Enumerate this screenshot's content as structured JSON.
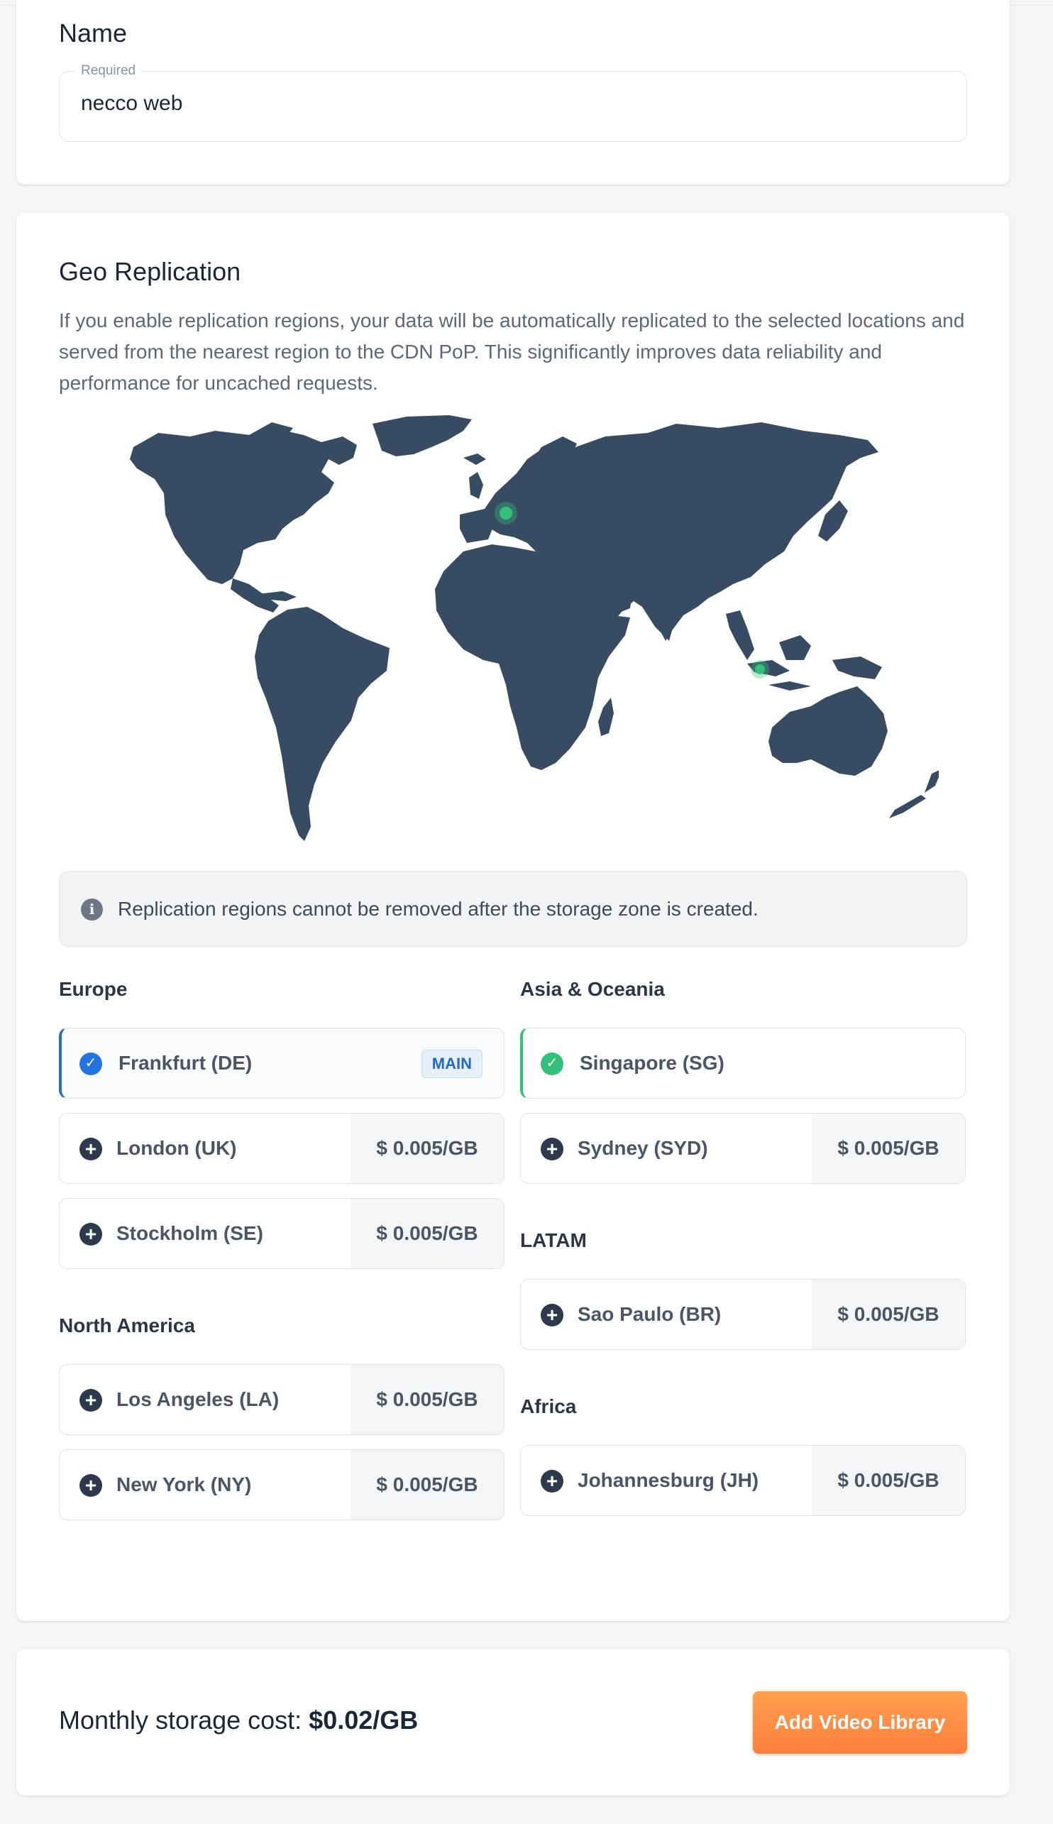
{
  "name_section": {
    "title": "Name",
    "field_label": "Required",
    "field_value": "necco web"
  },
  "geo": {
    "title": "Geo Replication",
    "description": "If you enable replication regions, your data will be automatically replicated to the selected locations and served from the nearest region to the CDN PoP. This significantly improves data reliability and performance for uncached requests.",
    "notice": "Replication regions cannot be removed after the storage zone is created.",
    "groups": {
      "europe": {
        "title": "Europe",
        "items": [
          {
            "label": "Frankfurt (DE)",
            "badge": "MAIN",
            "state": "main"
          },
          {
            "label": "London (UK)",
            "price": "$ 0.005/GB",
            "state": "add"
          },
          {
            "label": "Stockholm (SE)",
            "price": "$ 0.005/GB",
            "state": "add"
          }
        ]
      },
      "north_america": {
        "title": "North America",
        "items": [
          {
            "label": "Los Angeles (LA)",
            "price": "$ 0.005/GB",
            "state": "add"
          },
          {
            "label": "New York (NY)",
            "price": "$ 0.005/GB",
            "state": "add"
          }
        ]
      },
      "asia": {
        "title": "Asia & Oceania",
        "items": [
          {
            "label": "Singapore (SG)",
            "state": "selected"
          },
          {
            "label": "Sydney (SYD)",
            "price": "$ 0.005/GB",
            "state": "add"
          }
        ]
      },
      "latam": {
        "title": "LATAM",
        "items": [
          {
            "label": "Sao Paulo (BR)",
            "price": "$ 0.005/GB",
            "state": "add"
          }
        ]
      },
      "africa": {
        "title": "Africa",
        "items": [
          {
            "label": "Johannesburg (JH)",
            "price": "$ 0.005/GB",
            "state": "add"
          }
        ]
      }
    }
  },
  "cost": {
    "label": "Monthly storage cost: ",
    "value": "$0.02/GB",
    "button": "Add Video Library"
  },
  "colors": {
    "map_land": "#374b63",
    "accent_blue": "#2374e1",
    "accent_green": "#33c07a",
    "button_orange": "#ff8c42"
  }
}
